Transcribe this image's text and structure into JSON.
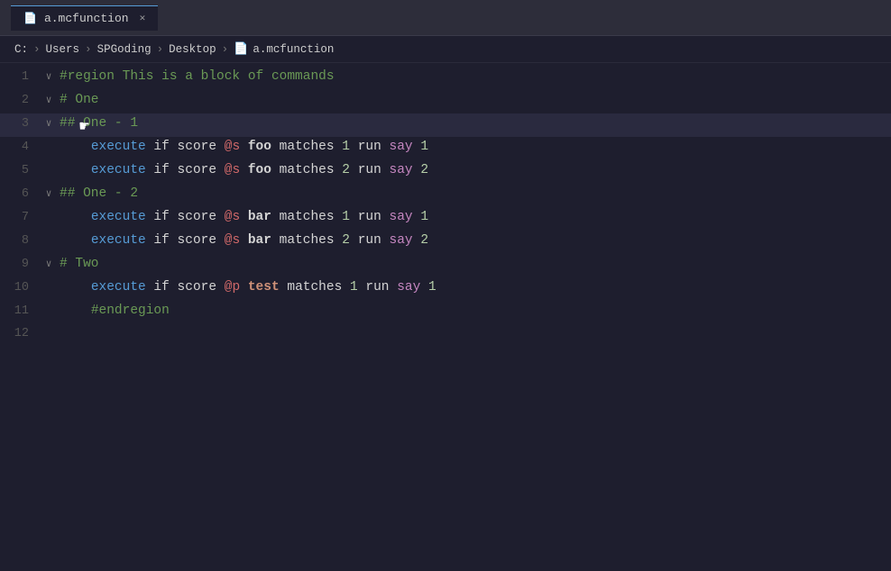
{
  "tab": {
    "filename": "a.mcfunction",
    "close_label": "✕"
  },
  "breadcrumb": {
    "parts": [
      "C:",
      "Users",
      "SPGoding",
      "Desktop"
    ],
    "filename": "a.mcfunction"
  },
  "lines": [
    {
      "number": "1",
      "fold": "∨",
      "tokens": [
        {
          "text": "#region This is a block of commands",
          "class": "c-region"
        }
      ]
    },
    {
      "number": "2",
      "fold": "∨",
      "tokens": [
        {
          "text": "# One",
          "class": "c-comment"
        }
      ]
    },
    {
      "number": "3",
      "fold": "∨",
      "tokens": [
        {
          "text": "## One - 1",
          "class": "c-comment"
        }
      ],
      "cursor": true
    },
    {
      "number": "4",
      "fold": "",
      "tokens": [
        {
          "text": "    "
        },
        {
          "text": "execute",
          "class": "c-keyword"
        },
        {
          "text": " if score "
        },
        {
          "text": "@s",
          "class": "c-at"
        },
        {
          "text": " "
        },
        {
          "text": "foo",
          "class": "c-command-bold"
        },
        {
          "text": " matches "
        },
        {
          "text": "1",
          "class": "c-number"
        },
        {
          "text": " run "
        },
        {
          "text": "say",
          "class": "c-say"
        },
        {
          "text": " "
        },
        {
          "text": "1",
          "class": "c-number"
        }
      ]
    },
    {
      "number": "5",
      "fold": "",
      "tokens": [
        {
          "text": "    "
        },
        {
          "text": "execute",
          "class": "c-keyword"
        },
        {
          "text": " if score "
        },
        {
          "text": "@s",
          "class": "c-at"
        },
        {
          "text": " "
        },
        {
          "text": "foo",
          "class": "c-command-bold"
        },
        {
          "text": " matches "
        },
        {
          "text": "2",
          "class": "c-number"
        },
        {
          "text": " run "
        },
        {
          "text": "say",
          "class": "c-say"
        },
        {
          "text": " "
        },
        {
          "text": "2",
          "class": "c-number"
        }
      ]
    },
    {
      "number": "6",
      "fold": "∨",
      "tokens": [
        {
          "text": "## One - 2",
          "class": "c-comment"
        }
      ]
    },
    {
      "number": "7",
      "fold": "",
      "tokens": [
        {
          "text": "    "
        },
        {
          "text": "execute",
          "class": "c-keyword"
        },
        {
          "text": " if score "
        },
        {
          "text": "@s",
          "class": "c-at"
        },
        {
          "text": " "
        },
        {
          "text": "bar",
          "class": "c-command-bold"
        },
        {
          "text": " matches "
        },
        {
          "text": "1",
          "class": "c-number"
        },
        {
          "text": " run "
        },
        {
          "text": "say",
          "class": "c-say"
        },
        {
          "text": " "
        },
        {
          "text": "1",
          "class": "c-number"
        }
      ]
    },
    {
      "number": "8",
      "fold": "",
      "tokens": [
        {
          "text": "    "
        },
        {
          "text": "execute",
          "class": "c-keyword"
        },
        {
          "text": " if score "
        },
        {
          "text": "@s",
          "class": "c-at"
        },
        {
          "text": " "
        },
        {
          "text": "bar",
          "class": "c-command-bold"
        },
        {
          "text": " matches "
        },
        {
          "text": "2",
          "class": "c-number"
        },
        {
          "text": " run "
        },
        {
          "text": "say",
          "class": "c-say"
        },
        {
          "text": " "
        },
        {
          "text": "2",
          "class": "c-number"
        }
      ]
    },
    {
      "number": "9",
      "fold": "∨",
      "tokens": [
        {
          "text": "# Two",
          "class": "c-comment"
        }
      ]
    },
    {
      "number": "10",
      "fold": "",
      "tokens": [
        {
          "text": "    "
        },
        {
          "text": "execute",
          "class": "c-keyword"
        },
        {
          "text": " if score "
        },
        {
          "text": "@p",
          "class": "c-at"
        },
        {
          "text": " "
        },
        {
          "text": "test",
          "class": "c-bold"
        },
        {
          "text": " matches "
        },
        {
          "text": "1",
          "class": "c-number"
        },
        {
          "text": " run "
        },
        {
          "text": "say",
          "class": "c-say"
        },
        {
          "text": " "
        },
        {
          "text": "1",
          "class": "c-number"
        }
      ]
    },
    {
      "number": "11",
      "fold": "",
      "tokens": [
        {
          "text": "    "
        },
        {
          "text": "#endregion",
          "class": "c-region"
        }
      ]
    },
    {
      "number": "12",
      "fold": "",
      "tokens": [
        {
          "text": ""
        }
      ]
    }
  ]
}
